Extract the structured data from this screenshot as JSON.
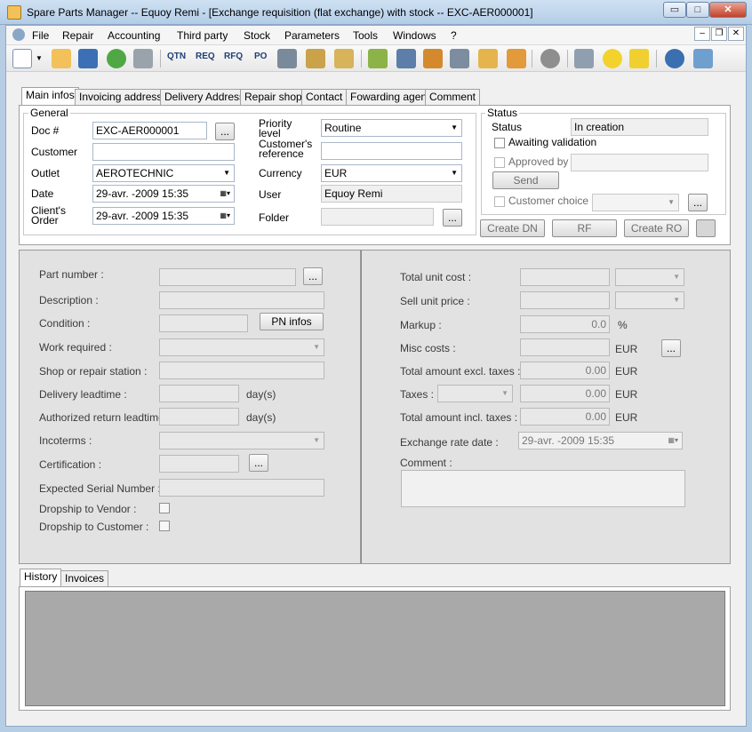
{
  "window": {
    "title": "Spare Parts Manager -- Equoy Remi - [Exchange requisition (flat exchange) with stock -- EXC-AER000001]",
    "min_label": "▭",
    "max_label": "□",
    "close_label": "✕"
  },
  "menu": {
    "file": "File",
    "repair": "Repair",
    "accounting": "Accounting",
    "third_party": "Third party",
    "stock": "Stock",
    "parameters": "Parameters",
    "tools": "Tools",
    "windows": "Windows",
    "help": "?"
  },
  "mdi": {
    "min": "–",
    "restore": "❐",
    "close": "✕"
  },
  "toolbar": {
    "qtn": "QTN",
    "req": "REQ",
    "rfq": "RFQ",
    "po": "PO"
  },
  "tabs": {
    "main_infos": "Main infos",
    "invoicing": "Invoicing address",
    "delivery": "Delivery Address",
    "repair_shop": "Repair shop",
    "contact": "Contact",
    "forwarding": "Fowarding agent",
    "comment": "Comment"
  },
  "general": {
    "group_title": "General",
    "doc_label": "Doc #",
    "doc_value": "EXC-AER000001",
    "customer_label": "Customer",
    "customer_value": "",
    "outlet_label": "Outlet",
    "outlet_value": "AEROTECHNIC",
    "date_label": "Date",
    "date_value": "29-avr. -2009 15:35",
    "client_order_label": "Client's Order",
    "client_order_value": "29-avr. -2009 15:35",
    "priority_label": "Priority level",
    "priority_value": "Routine",
    "cust_ref_label": "Customer's reference",
    "cust_ref_value": "",
    "currency_label": "Currency",
    "currency_value": "EUR",
    "user_label": "User",
    "user_value": "Equoy Remi",
    "folder_label": "Folder",
    "folder_value": "",
    "browse": "..."
  },
  "status": {
    "group_title": "Status",
    "status_label": "Status",
    "status_value": "In creation",
    "awaiting_label": "Awaiting validation",
    "approved_label": "Approved by",
    "approved_value": "",
    "send_label": "Send",
    "customer_choice_label": "Customer choice",
    "browse": "..."
  },
  "actions": {
    "create_dn": "Create DN",
    "rf": "RF",
    "create_ro": "Create RO"
  },
  "part": {
    "part_number": "Part number :",
    "description": "Description :",
    "condition": "Condition :",
    "pn_infos": "PN infos",
    "work_required": "Work required :",
    "shop": "Shop or repair station :",
    "delivery_leadtime": "Delivery leadtime :",
    "return_leadtime": "Authorized return leadtime :",
    "days": "day(s)",
    "incoterms": "Incoterms :",
    "certification": "Certification :",
    "serial": "Expected Serial Number :",
    "dropship_vendor": "Dropship to Vendor :",
    "dropship_customer": "Dropship to Customer :",
    "browse": "..."
  },
  "costs": {
    "total_unit_cost": "Total unit cost :",
    "sell_unit_price": "Sell unit price :",
    "markup": "Markup :",
    "markup_value": "0.0",
    "percent": "%",
    "misc_costs": "Misc costs :",
    "total_excl": "Total amount excl. taxes :",
    "total_excl_value": "0.00",
    "taxes": "Taxes :",
    "taxes_value": "0.00",
    "total_incl": "Total amount incl. taxes :",
    "total_incl_value": "0.00",
    "eur": "EUR",
    "exchange_rate_date": "Exchange rate date :",
    "exchange_rate_value": "29-avr. -2009 15:35",
    "comment": "Comment :",
    "browse": "..."
  },
  "bottom_tabs": {
    "history": "History",
    "invoices": "Invoices"
  },
  "icons": [
    "new-icon",
    "open-folder-icon",
    "save-icon",
    "refresh-icon",
    "print-icon",
    "settings-plugin-icon",
    "wrench-hammer-icon",
    "gear-icon",
    "tools-icon",
    "star-icon",
    "banana-icon",
    "globe-icon",
    "notepad-icon"
  ]
}
